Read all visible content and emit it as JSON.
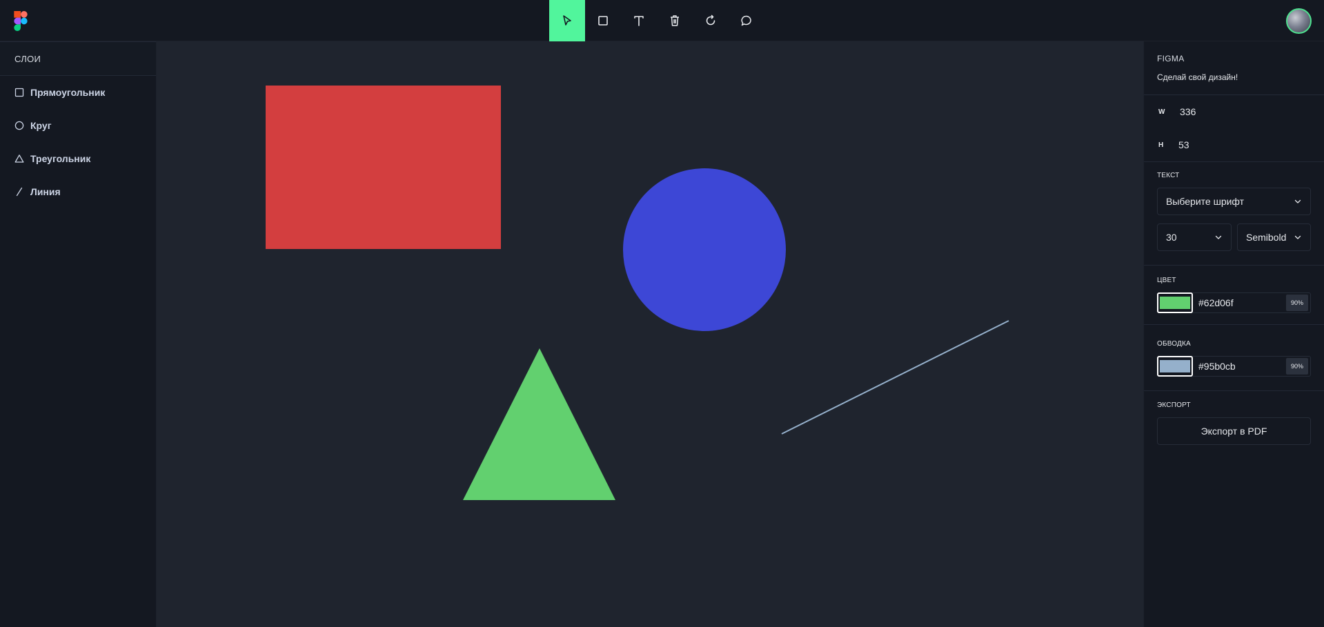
{
  "app": {
    "logo_icon": "figma-logo-icon"
  },
  "toolbar": {
    "tools": [
      {
        "name": "select",
        "icon": "cursor-icon",
        "active": true
      },
      {
        "name": "rectangle",
        "icon": "square-icon",
        "active": false
      },
      {
        "name": "text",
        "icon": "text-icon",
        "active": false
      },
      {
        "name": "delete",
        "icon": "trash-icon",
        "active": false
      },
      {
        "name": "reset",
        "icon": "rotate-icon",
        "active": false
      },
      {
        "name": "comment",
        "icon": "comment-icon",
        "active": false
      }
    ],
    "active_color": "#51f59c"
  },
  "layers": {
    "header": "СЛОИ",
    "items": [
      {
        "label": "Прямоугольник",
        "icon": "square-icon"
      },
      {
        "label": "Круг",
        "icon": "circle-icon"
      },
      {
        "label": "Треугольник",
        "icon": "triangle-icon"
      },
      {
        "label": "Линия",
        "icon": "line-icon"
      }
    ]
  },
  "canvas": {
    "shapes": [
      {
        "type": "rectangle",
        "color": "#d33e3f"
      },
      {
        "type": "circle",
        "color": "#3d47d6"
      },
      {
        "type": "triangle",
        "color": "#62d06f"
      },
      {
        "type": "line",
        "color": "#95b0cb"
      }
    ]
  },
  "panel": {
    "brand_title": "FIGMA",
    "brand_subtitle": "Сделай свой дизайн!",
    "width_label": "W",
    "width_value": "336",
    "height_label": "H",
    "height_value": "53",
    "text_label": "ТЕКСТ",
    "font_select": "Выберите шрифт",
    "font_size": "30",
    "font_weight": "Semibold",
    "color_label": "ЦВЕТ",
    "color_hex": "#62d06f",
    "color_opacity": "90%",
    "stroke_label": "ОБВОДКА",
    "stroke_hex": "#95b0cb",
    "stroke_opacity": "90%",
    "export_label": "ЭКСПОРТ",
    "export_button": "Экспорт в PDF"
  }
}
